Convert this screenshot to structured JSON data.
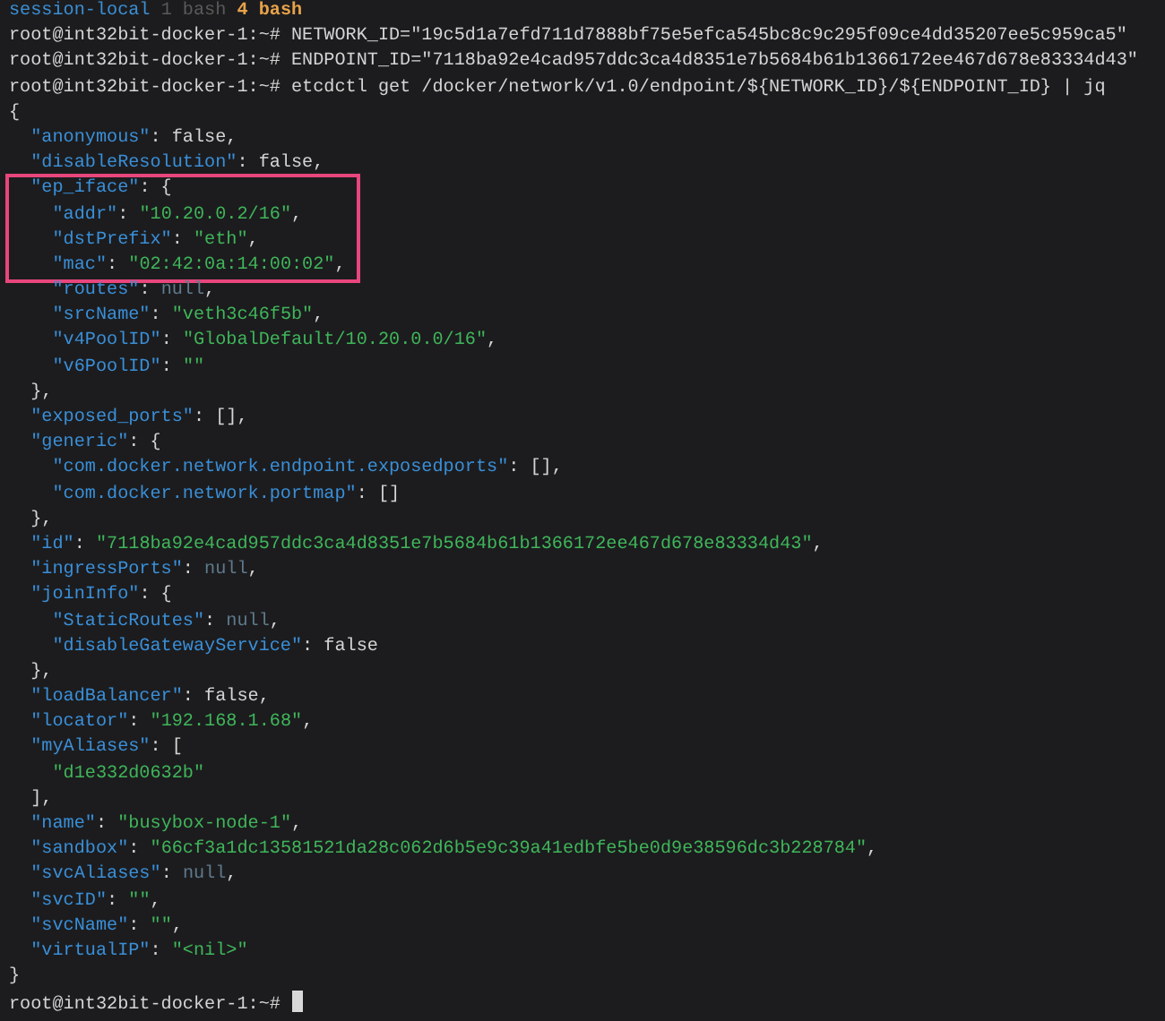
{
  "status_bar": {
    "session": "session-local",
    "windows": [
      {
        "label": "1 bash",
        "selected": false
      },
      {
        "label": "4 bash",
        "selected": true
      }
    ]
  },
  "terminal": {
    "cursor": true,
    "lines": [
      {
        "highlighted": false,
        "tokens": [
          {
            "kind": "plain",
            "text": "root@int32bit-docker-1:~# NETWORK_ID=\"19c5d1a7efd711d7888bf75e5efca545bc8c9c295f09ce4dd35207ee5c959ca5\""
          }
        ]
      },
      {
        "highlighted": false,
        "tokens": [
          {
            "kind": "plain",
            "text": "root@int32bit-docker-1:~# ENDPOINT_ID=\"7118ba92e4cad957ddc3ca4d8351e7b5684b61b1366172ee467d678e83334d43\""
          }
        ]
      },
      {
        "highlighted": false,
        "tokens": [
          {
            "kind": "plain",
            "text": "root@int32bit-docker-1:~# etcdctl get /docker/network/v1.0/endpoint/${NETWORK_ID}/${ENDPOINT_ID} | jq"
          }
        ]
      },
      {
        "highlighted": false,
        "tokens": [
          {
            "kind": "plain",
            "text": "{"
          }
        ]
      },
      {
        "highlighted": false,
        "tokens": [
          {
            "kind": "key",
            "text": "  \"anonymous\""
          },
          {
            "kind": "plain",
            "text": ": false,"
          }
        ]
      },
      {
        "highlighted": false,
        "tokens": [
          {
            "kind": "key",
            "text": "  \"disableResolution\""
          },
          {
            "kind": "plain",
            "text": ": false,"
          }
        ]
      },
      {
        "highlighted": true,
        "tokens": [
          {
            "kind": "key",
            "text": "  \"ep_iface\""
          },
          {
            "kind": "plain",
            "text": ": {"
          }
        ]
      },
      {
        "highlighted": true,
        "tokens": [
          {
            "kind": "key",
            "text": "    \"addr\""
          },
          {
            "kind": "plain",
            "text": ": "
          },
          {
            "kind": "string",
            "text": "\"10.20.0.2/16\""
          },
          {
            "kind": "plain",
            "text": ","
          }
        ]
      },
      {
        "highlighted": true,
        "tokens": [
          {
            "kind": "key",
            "text": "    \"dstPrefix\""
          },
          {
            "kind": "plain",
            "text": ": "
          },
          {
            "kind": "string",
            "text": "\"eth\""
          },
          {
            "kind": "plain",
            "text": ","
          }
        ]
      },
      {
        "highlighted": true,
        "tokens": [
          {
            "kind": "key",
            "text": "    \"mac\""
          },
          {
            "kind": "plain",
            "text": ": "
          },
          {
            "kind": "string",
            "text": "\"02:42:0a:14:00:02\""
          },
          {
            "kind": "plain",
            "text": ","
          }
        ]
      },
      {
        "highlighted": false,
        "tokens": [
          {
            "kind": "key",
            "text": "    \"routes\""
          },
          {
            "kind": "plain",
            "text": ": "
          },
          {
            "kind": "null",
            "text": "null"
          },
          {
            "kind": "plain",
            "text": ","
          }
        ]
      },
      {
        "highlighted": false,
        "tokens": [
          {
            "kind": "key",
            "text": "    \"srcName\""
          },
          {
            "kind": "plain",
            "text": ": "
          },
          {
            "kind": "string",
            "text": "\"veth3c46f5b\""
          },
          {
            "kind": "plain",
            "text": ","
          }
        ]
      },
      {
        "highlighted": false,
        "tokens": [
          {
            "kind": "key",
            "text": "    \"v4PoolID\""
          },
          {
            "kind": "plain",
            "text": ": "
          },
          {
            "kind": "string",
            "text": "\"GlobalDefault/10.20.0.0/16\""
          },
          {
            "kind": "plain",
            "text": ","
          }
        ]
      },
      {
        "highlighted": false,
        "tokens": [
          {
            "kind": "key",
            "text": "    \"v6PoolID\""
          },
          {
            "kind": "plain",
            "text": ": "
          },
          {
            "kind": "string",
            "text": "\"\""
          }
        ]
      },
      {
        "highlighted": false,
        "tokens": [
          {
            "kind": "plain",
            "text": "  },"
          }
        ]
      },
      {
        "highlighted": false,
        "tokens": [
          {
            "kind": "key",
            "text": "  \"exposed_ports\""
          },
          {
            "kind": "plain",
            "text": ": [],"
          }
        ]
      },
      {
        "highlighted": false,
        "tokens": [
          {
            "kind": "key",
            "text": "  \"generic\""
          },
          {
            "kind": "plain",
            "text": ": {"
          }
        ]
      },
      {
        "highlighted": false,
        "tokens": [
          {
            "kind": "key",
            "text": "    \"com.docker.network.endpoint.exposedports\""
          },
          {
            "kind": "plain",
            "text": ": [],"
          }
        ]
      },
      {
        "highlighted": false,
        "tokens": [
          {
            "kind": "key",
            "text": "    \"com.docker.network.portmap\""
          },
          {
            "kind": "plain",
            "text": ": []"
          }
        ]
      },
      {
        "highlighted": false,
        "tokens": [
          {
            "kind": "plain",
            "text": "  },"
          }
        ]
      },
      {
        "highlighted": false,
        "tokens": [
          {
            "kind": "key",
            "text": "  \"id\""
          },
          {
            "kind": "plain",
            "text": ": "
          },
          {
            "kind": "string",
            "text": "\"7118ba92e4cad957ddc3ca4d8351e7b5684b61b1366172ee467d678e83334d43\""
          },
          {
            "kind": "plain",
            "text": ","
          }
        ]
      },
      {
        "highlighted": false,
        "tokens": [
          {
            "kind": "key",
            "text": "  \"ingressPorts\""
          },
          {
            "kind": "plain",
            "text": ": "
          },
          {
            "kind": "null",
            "text": "null"
          },
          {
            "kind": "plain",
            "text": ","
          }
        ]
      },
      {
        "highlighted": false,
        "tokens": [
          {
            "kind": "key",
            "text": "  \"joinInfo\""
          },
          {
            "kind": "plain",
            "text": ": {"
          }
        ]
      },
      {
        "highlighted": false,
        "tokens": [
          {
            "kind": "key",
            "text": "    \"StaticRoutes\""
          },
          {
            "kind": "plain",
            "text": ": "
          },
          {
            "kind": "null",
            "text": "null"
          },
          {
            "kind": "plain",
            "text": ","
          }
        ]
      },
      {
        "highlighted": false,
        "tokens": [
          {
            "kind": "key",
            "text": "    \"disableGatewayService\""
          },
          {
            "kind": "plain",
            "text": ": false"
          }
        ]
      },
      {
        "highlighted": false,
        "tokens": [
          {
            "kind": "plain",
            "text": "  },"
          }
        ]
      },
      {
        "highlighted": false,
        "tokens": [
          {
            "kind": "key",
            "text": "  \"loadBalancer\""
          },
          {
            "kind": "plain",
            "text": ": false,"
          }
        ]
      },
      {
        "highlighted": false,
        "tokens": [
          {
            "kind": "key",
            "text": "  \"locator\""
          },
          {
            "kind": "plain",
            "text": ": "
          },
          {
            "kind": "string",
            "text": "\"192.168.1.68\""
          },
          {
            "kind": "plain",
            "text": ","
          }
        ]
      },
      {
        "highlighted": false,
        "tokens": [
          {
            "kind": "key",
            "text": "  \"myAliases\""
          },
          {
            "kind": "plain",
            "text": ": ["
          }
        ]
      },
      {
        "highlighted": false,
        "tokens": [
          {
            "kind": "string",
            "text": "    \"d1e332d0632b\""
          }
        ]
      },
      {
        "highlighted": false,
        "tokens": [
          {
            "kind": "plain",
            "text": "  ],"
          }
        ]
      },
      {
        "highlighted": false,
        "tokens": [
          {
            "kind": "key",
            "text": "  \"name\""
          },
          {
            "kind": "plain",
            "text": ": "
          },
          {
            "kind": "string",
            "text": "\"busybox-node-1\""
          },
          {
            "kind": "plain",
            "text": ","
          }
        ]
      },
      {
        "highlighted": false,
        "tokens": [
          {
            "kind": "key",
            "text": "  \"sandbox\""
          },
          {
            "kind": "plain",
            "text": ": "
          },
          {
            "kind": "string",
            "text": "\"66cf3a1dc13581521da28c062d6b5e9c39a41edbfe5be0d9e38596dc3b228784\""
          },
          {
            "kind": "plain",
            "text": ","
          }
        ]
      },
      {
        "highlighted": false,
        "tokens": [
          {
            "kind": "key",
            "text": "  \"svcAliases\""
          },
          {
            "kind": "plain",
            "text": ": "
          },
          {
            "kind": "null",
            "text": "null"
          },
          {
            "kind": "plain",
            "text": ","
          }
        ]
      },
      {
        "highlighted": false,
        "tokens": [
          {
            "kind": "key",
            "text": "  \"svcID\""
          },
          {
            "kind": "plain",
            "text": ": "
          },
          {
            "kind": "string",
            "text": "\"\""
          },
          {
            "kind": "plain",
            "text": ","
          }
        ]
      },
      {
        "highlighted": false,
        "tokens": [
          {
            "kind": "key",
            "text": "  \"svcName\""
          },
          {
            "kind": "plain",
            "text": ": "
          },
          {
            "kind": "string",
            "text": "\"\""
          },
          {
            "kind": "plain",
            "text": ","
          }
        ]
      },
      {
        "highlighted": false,
        "tokens": [
          {
            "kind": "key",
            "text": "  \"virtualIP\""
          },
          {
            "kind": "plain",
            "text": ": "
          },
          {
            "kind": "string",
            "text": "\"<nil>\""
          }
        ]
      },
      {
        "highlighted": false,
        "tokens": [
          {
            "kind": "plain",
            "text": "}"
          }
        ]
      },
      {
        "highlighted": false,
        "tokens": [
          {
            "kind": "plain",
            "text": "root@int32bit-docker-1:~# "
          }
        ]
      }
    ]
  }
}
